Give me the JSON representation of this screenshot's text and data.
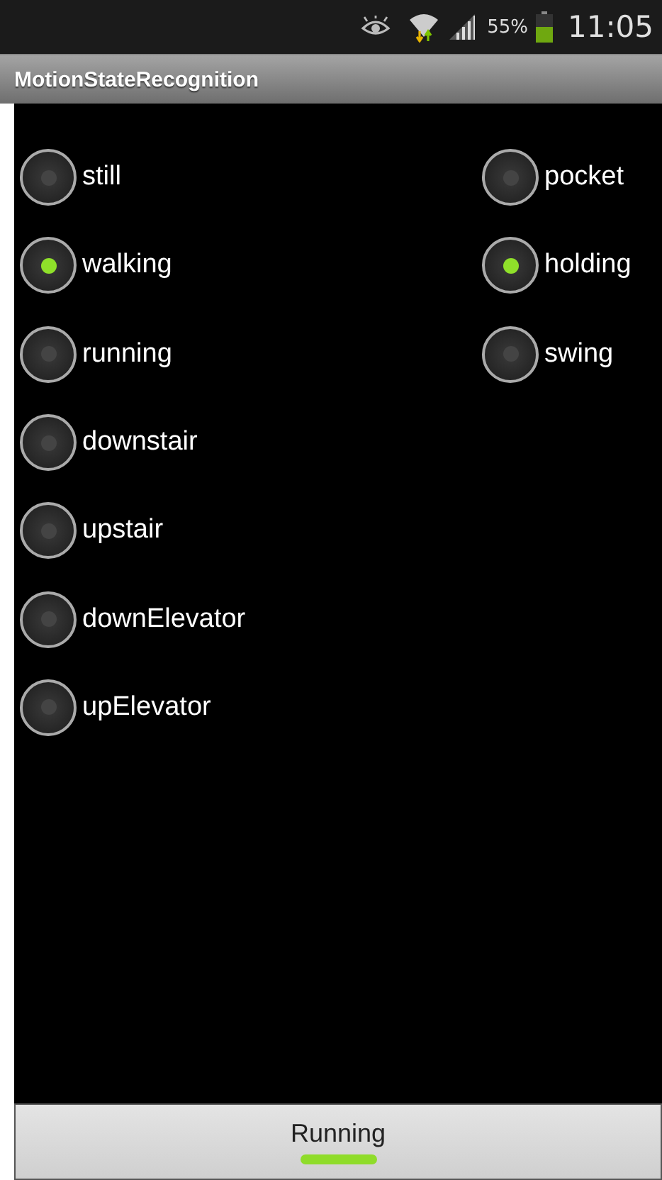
{
  "status_bar": {
    "battery_percent": "55%",
    "time": "11:05"
  },
  "title_bar": {
    "title": "MotionStateRecognition"
  },
  "motion_group": {
    "items": [
      {
        "label": "still",
        "selected": false
      },
      {
        "label": "walking",
        "selected": true
      },
      {
        "label": "running",
        "selected": false
      },
      {
        "label": "downstair",
        "selected": false
      },
      {
        "label": "upstair",
        "selected": false
      },
      {
        "label": "downElevator",
        "selected": false
      },
      {
        "label": "upElevator",
        "selected": false
      }
    ]
  },
  "position_group": {
    "items": [
      {
        "label": "pocket",
        "selected": false
      },
      {
        "label": "holding",
        "selected": true
      },
      {
        "label": "swing",
        "selected": false
      }
    ]
  },
  "toggle_button": {
    "label": "Running",
    "on": true
  }
}
